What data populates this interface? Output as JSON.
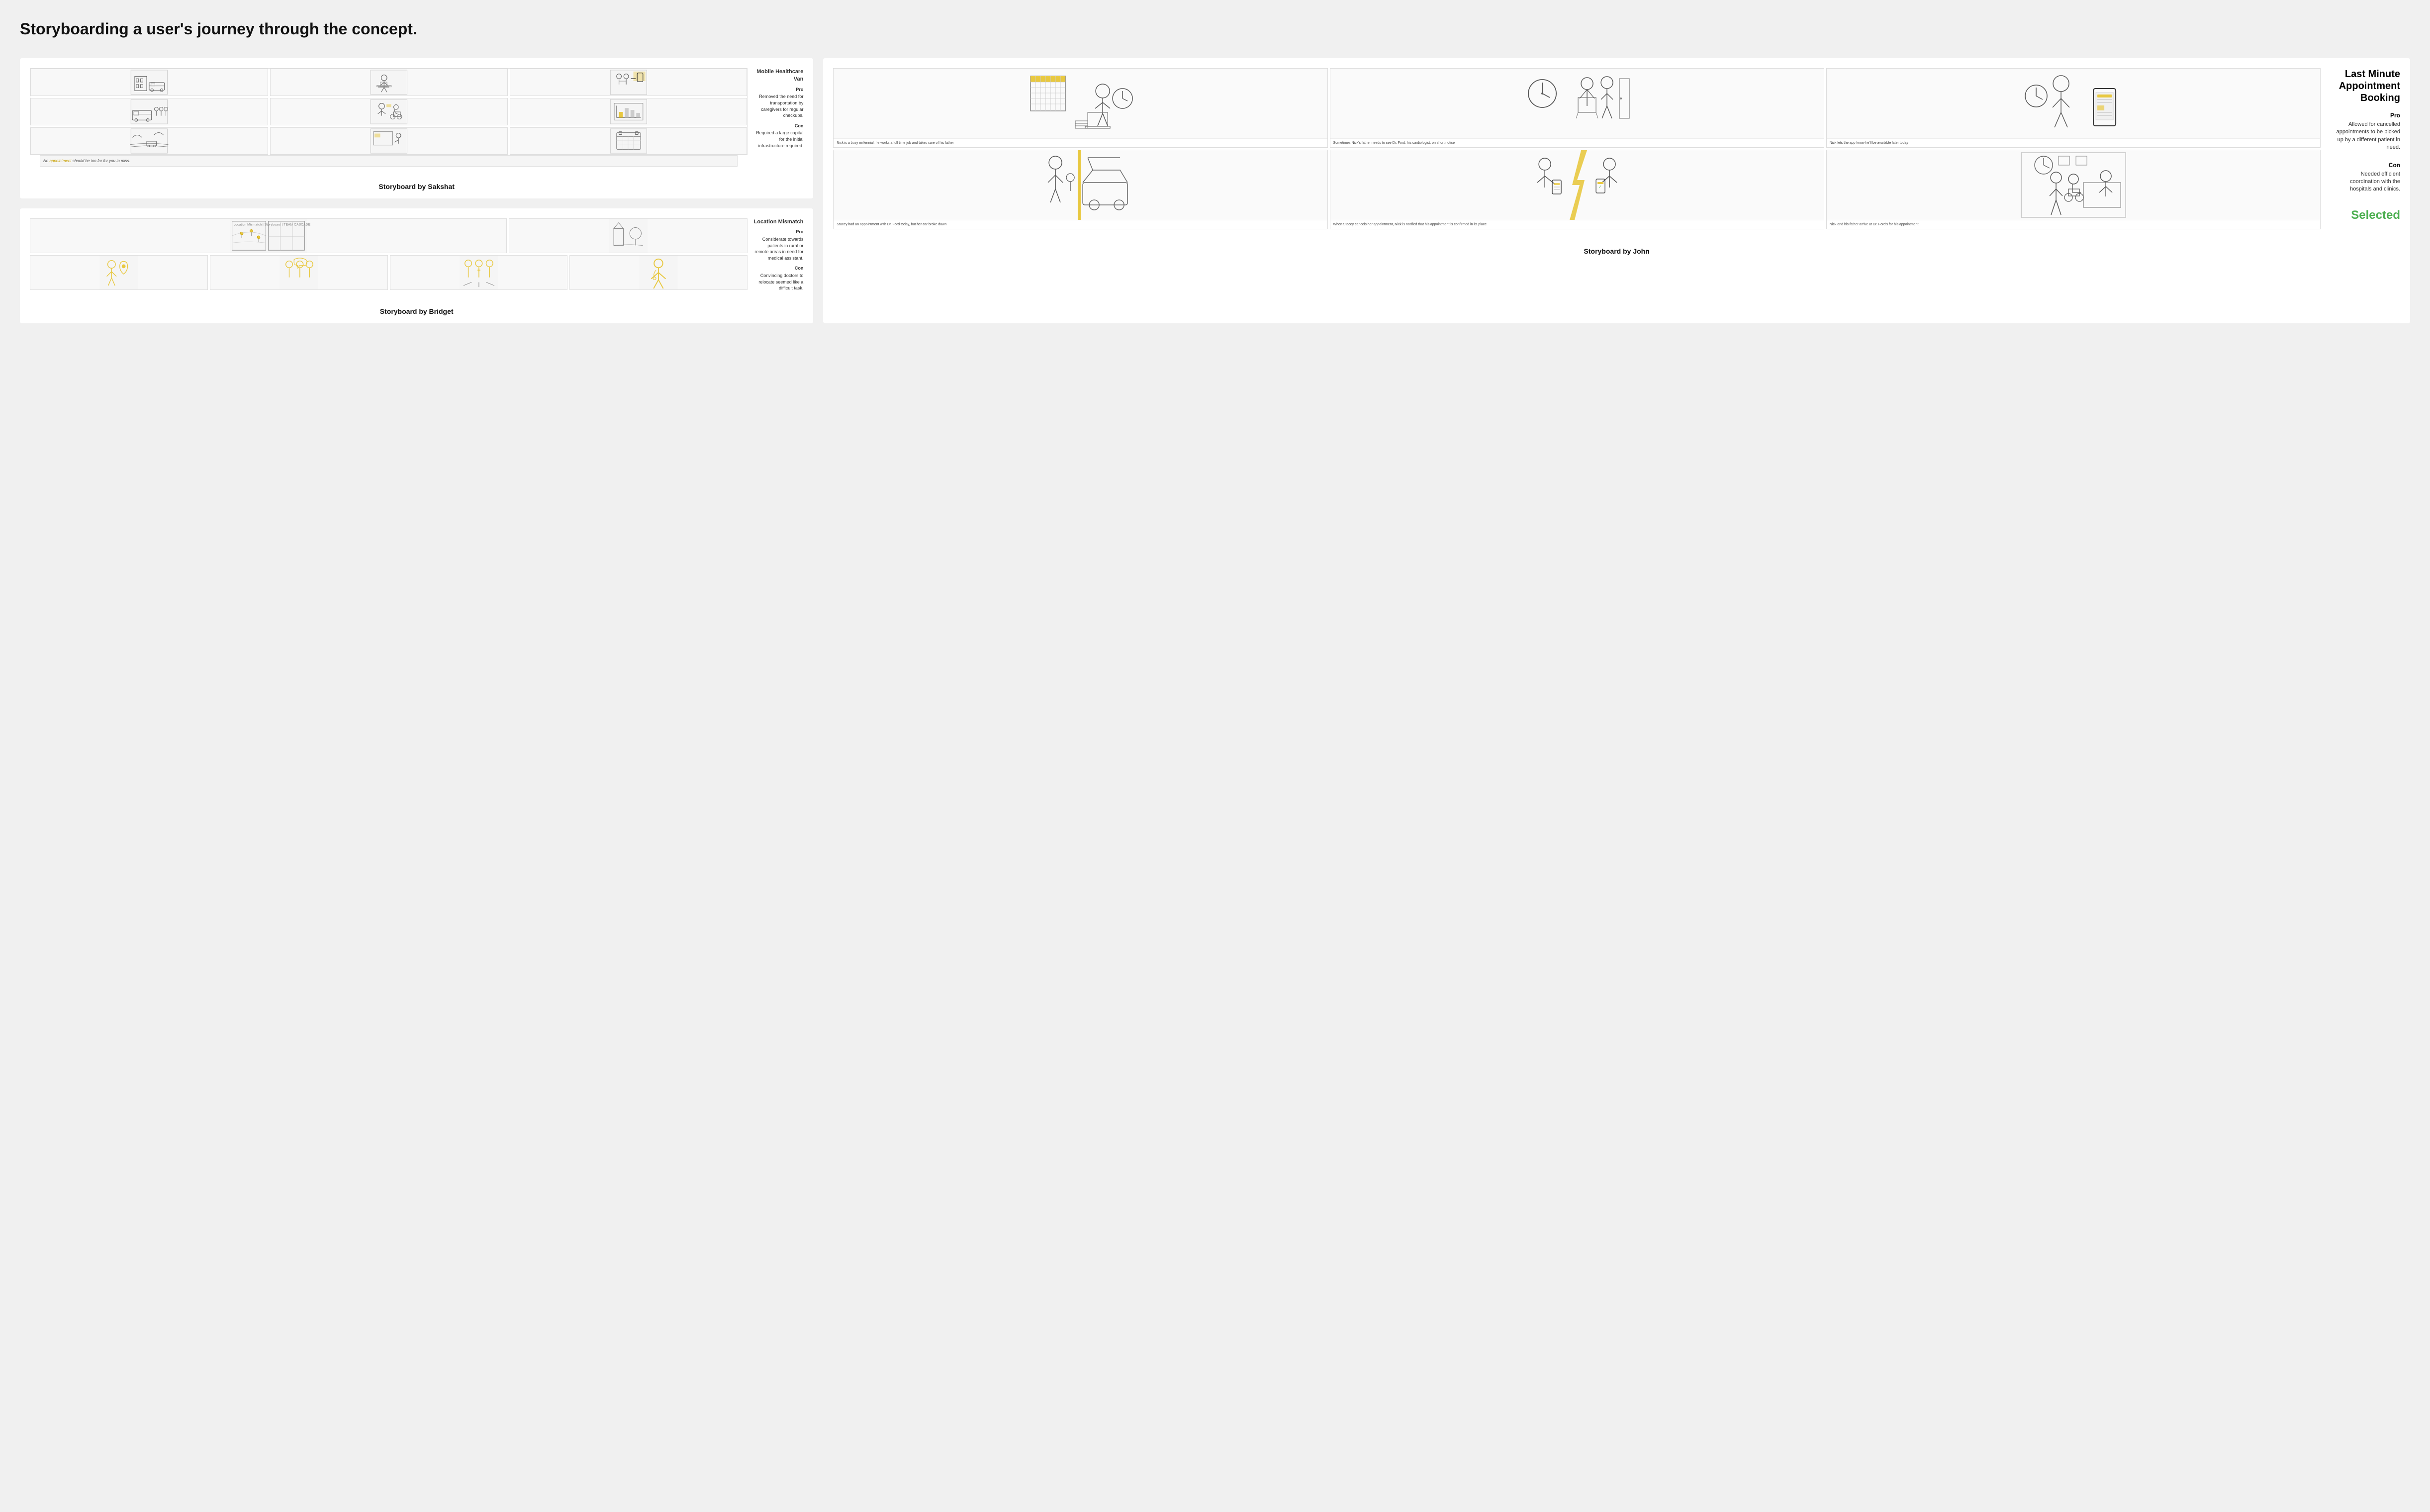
{
  "page": {
    "title": "Storyboarding a user's journey through the concept."
  },
  "sakshat": {
    "concept_title": "Mobile Healthcare Van",
    "pro_label": "Pro",
    "pro_text": "Removed the need for transportation by caregivers for regular checkups.",
    "con_label": "Con",
    "con_text": "Required a large capital for the initial infrastructure required.",
    "caption": "No appointment should be too far for you to miss.",
    "card_label": "Storyboard by Sakshat"
  },
  "bridget": {
    "concept_title": "Location Mismatch",
    "pro_label": "Pro",
    "pro_text": "Considerate towards patients in rural or remote areas in need for medical assistant.",
    "con_label": "Con",
    "con_text": "Convincing doctors to relocate seemed like a difficult task.",
    "card_label": "Storyboard by Bridget"
  },
  "john": {
    "concept_title": "Last Minute Appointment Booking",
    "pro_label": "Pro",
    "pro_text": "Allowed for cancelled appointments to be picked up by a different patient in need.",
    "con_label": "Con",
    "con_text": "Needed efficient coordination with the hospitals and clinics.",
    "panel_captions": [
      "Nick is a busy millennial, he works a full time job and takes care of his father",
      "Sometimes Nick's father needs to see Dr. Ford, his cardiologist, on short notice",
      "Nick lets the app know he'll be available later today",
      "Stacey had an appointment with Dr. Ford today, but her car broke down",
      "When Stacey cancels her appointment, Nick is notified that his appointment is confirmed in its place",
      "Nick and his father arrive at Dr. Ford's for his appointment"
    ],
    "selected_label": "Selected",
    "card_label": "Storyboard by John"
  }
}
